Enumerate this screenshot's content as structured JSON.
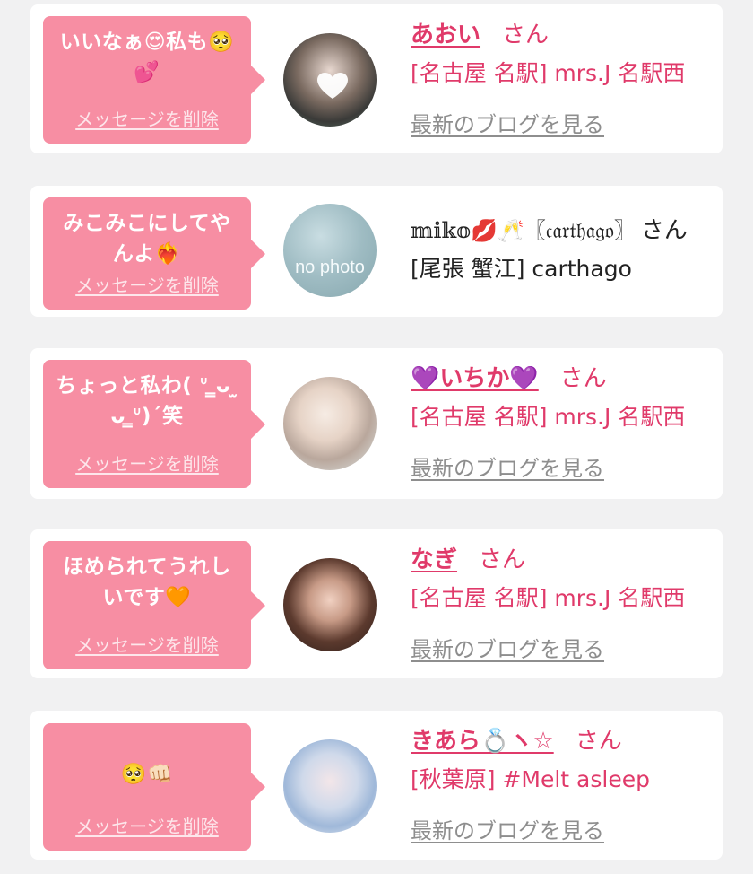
{
  "items": [
    {
      "message": "いいなぁ😍私も🥺💕",
      "delete_label": "メッセージを削除",
      "name": "あおい",
      "suffix": "さん",
      "shop": "[名古屋 名駅] mrs.J 名駅西",
      "blog_label": "最新のブログを見る"
    },
    {
      "message": "みこみこにしてやんよ❤️‍🔥",
      "delete_label": "メッセージを削除",
      "name": "𝕞𝕚𝕜𝕠💋🥂〖𝔠𝔞𝔯𝔱𝔥𝔞𝔤𝔬〗",
      "suffix": "さん",
      "shop": "[尾張 蟹江] carthago",
      "avatar_text": "no photo"
    },
    {
      "message": "ちょっと私わ( ᐡ ̳ᴗ ̫ ᴗ ̳ᐡ)´笑",
      "delete_label": "メッセージを削除",
      "name": "💜いちか💜",
      "suffix": "さん",
      "shop": "[名古屋 名駅] mrs.J 名駅西",
      "blog_label": "最新のブログを見る"
    },
    {
      "message": "ほめられてうれしいです🧡",
      "delete_label": "メッセージを削除",
      "name": "なぎ",
      "suffix": "さん",
      "shop": "[名古屋 名駅] mrs.J 名駅西",
      "blog_label": "最新のブログを見る"
    },
    {
      "message": "🥺👊🏻",
      "delete_label": "メッセージを削除",
      "name": "きあら💍ヽ☆",
      "suffix": "さん",
      "shop": "[秋葉原] #Melt asleep",
      "blog_label": "最新のブログを見る"
    }
  ],
  "colors": {
    "bubble": "#f78ea3",
    "accent": "#e03a6a",
    "blog_link": "#8e8e8e",
    "background": "#f1f1f2"
  }
}
